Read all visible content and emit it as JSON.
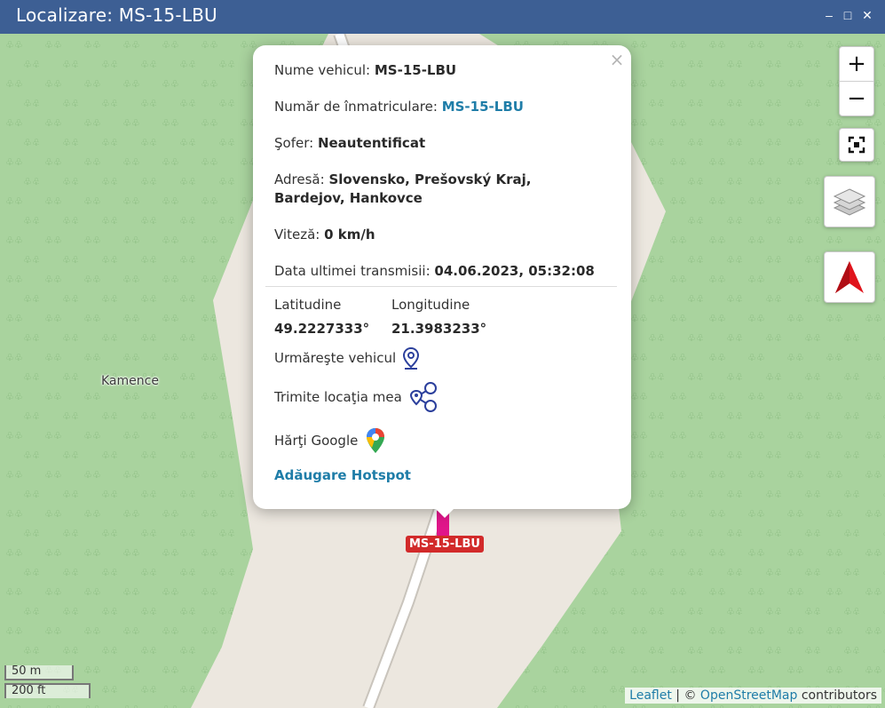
{
  "window": {
    "title": "Localizare: MS-15-LBU",
    "controls": [
      "minimize-icon",
      "maximize-icon",
      "close-icon"
    ],
    "minimize_glyph": "–",
    "maximize_glyph": "□",
    "close_glyph": "✕"
  },
  "map": {
    "place_label": "Kamence",
    "zoom_in": "+",
    "zoom_out": "−",
    "controls_icons": [
      "fullscreen-icon",
      "layers-icon",
      "north-arrow-icon"
    ],
    "scale_metric": "50 m",
    "scale_imperial": "200 ft",
    "attribution": {
      "leaflet": "Leaflet",
      "separator": "| ©",
      "osm": "OpenStreetMap",
      "contributors": "contributors"
    },
    "colors": {
      "forest": "#a9d39e",
      "land": "#ece7df",
      "road": "#ffffff"
    }
  },
  "popup": {
    "close": "×",
    "vehicle_name_label": "Nume vehicul:",
    "vehicle_name_value": "MS-15-LBU",
    "plate_label": "Număr de înmatriculare:",
    "plate_value": "MS-15-LBU",
    "driver_label": "Şofer:",
    "driver_value": "Neautentificat",
    "address_label": "Adresă:",
    "address_value": "Slovensko, Prešovský Kraj, Bardejov, Hankovce",
    "speed_label": "Viteză:",
    "speed_value": "0 km/h",
    "last_transmission_label": "Data ultimei transmisii:",
    "last_transmission_value": "04.06.2023, 05:32:08",
    "latitude_label": "Latitudine",
    "latitude_value": "49.2227333°",
    "longitude_label": "Longitudine",
    "longitude_value": "21.3983233°",
    "follow_vehicle": "Urmăreşte vehicul",
    "send_location": "Trimite locaţia mea",
    "google_maps": "Hărţi Google",
    "add_hotspot": "Adăugare Hotspot"
  },
  "marker": {
    "label": "MS-15-LBU",
    "label_color": "#d22a2a",
    "pin_color": "#e0168a"
  }
}
